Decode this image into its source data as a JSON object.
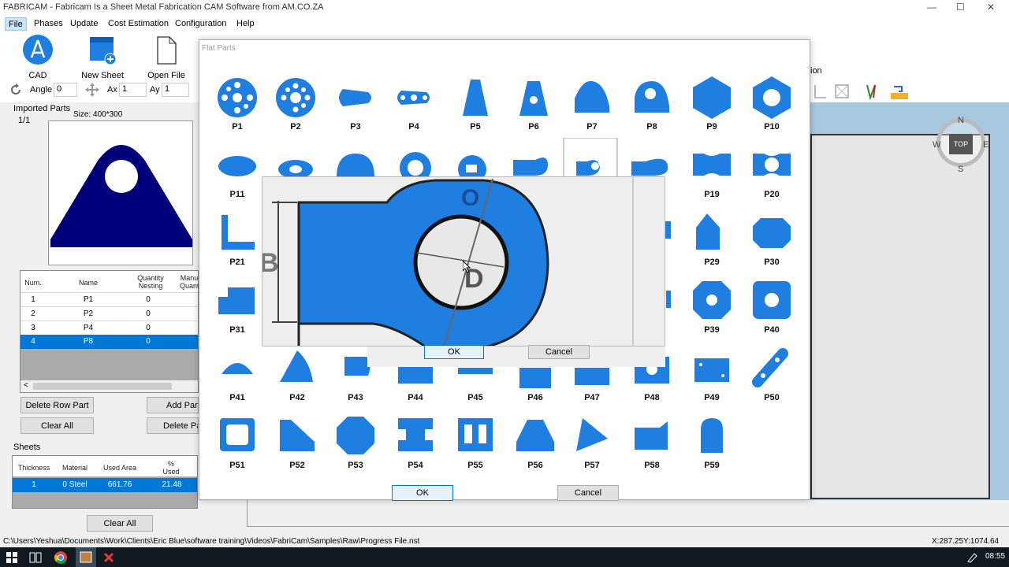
{
  "window": {
    "title": "FABRICAM - Fabricam Is a Sheet Metal Fabrication CAM Software from AM.CO.ZA",
    "min": "—",
    "max": "☐",
    "close": "✕"
  },
  "menu": [
    "File",
    "Phases",
    "Update",
    "Cost Estimation",
    "Configuration",
    "Help"
  ],
  "toolbar": {
    "cad": "CAD",
    "new_sheet": "New Sheet",
    "open_file": "Open File",
    "angle_label": "Angle",
    "angle_value": "0",
    "ax_label": "Ax",
    "ax_value": "1",
    "ay_label": "Ay",
    "ay_value": "1",
    "right_fragment": "ion"
  },
  "imported": {
    "title": "Imported Parts",
    "page": "1/1",
    "size": "Size: 400*300"
  },
  "parts_table": {
    "headers": [
      "Num.",
      "Name",
      "Quantity Nesting",
      "Manu Quant"
    ],
    "rows": [
      [
        "1",
        "P1",
        "0"
      ],
      [
        "2",
        "P2",
        "0"
      ],
      [
        "3",
        "P4",
        "0"
      ],
      [
        "4",
        "P8",
        "0"
      ]
    ],
    "selected": 3,
    "scroll_left": "<"
  },
  "left_buttons": {
    "delete_row": "Delete Row Part",
    "add_part": "Add Part >",
    "clear_all": "Clear All",
    "delete_part": "Delete Part"
  },
  "sheets": {
    "title": "Sheets",
    "headers": [
      "Thickness",
      "Material",
      "Used Area",
      "% Used"
    ],
    "row": [
      "1",
      "0  Steel",
      "661.76",
      "21.48"
    ],
    "clear_all": "Clear All"
  },
  "compass": {
    "n": "N",
    "s": "S",
    "e": "E",
    "w": "W",
    "top": "TOP"
  },
  "dialog": {
    "title": "Flat Parts",
    "ok": "OK",
    "cancel": "Cancel",
    "row1": [
      "P1",
      "P2",
      "P3",
      "P4",
      "P5",
      "P6",
      "P7",
      "P8",
      "P9",
      "P10"
    ],
    "row2": [
      "P11",
      "P19",
      "P20"
    ],
    "row3": [
      "P21",
      "P29",
      "P30"
    ],
    "row4": [
      "P31",
      "P39",
      "P40"
    ],
    "row5": [
      "P41",
      "P42",
      "P43",
      "P44",
      "P45",
      "P46",
      "P47",
      "P48",
      "P49",
      "P50"
    ],
    "row6": [
      "P51",
      "P52",
      "P53",
      "P54",
      "P55",
      "P56",
      "P57",
      "P58",
      "P59"
    ]
  },
  "zoom_popup": {
    "letter_o": "O",
    "letter_d": "D",
    "letter_b": "B",
    "ok": "OK",
    "cancel": "Cancel"
  },
  "status": {
    "path": "C:\\Users\\Yeshua\\Documents\\Work\\Clients\\Eric Blue\\software training\\Videos\\FabriCam\\Samples\\Raw\\Progress File.nst",
    "coords": "X:287.25Y:1074.64"
  },
  "taskbar": {
    "time": "08:55"
  },
  "colors": {
    "part_blue": "#1e7fe0",
    "preview_navy": "#00007a",
    "selection": "#0078d7"
  }
}
